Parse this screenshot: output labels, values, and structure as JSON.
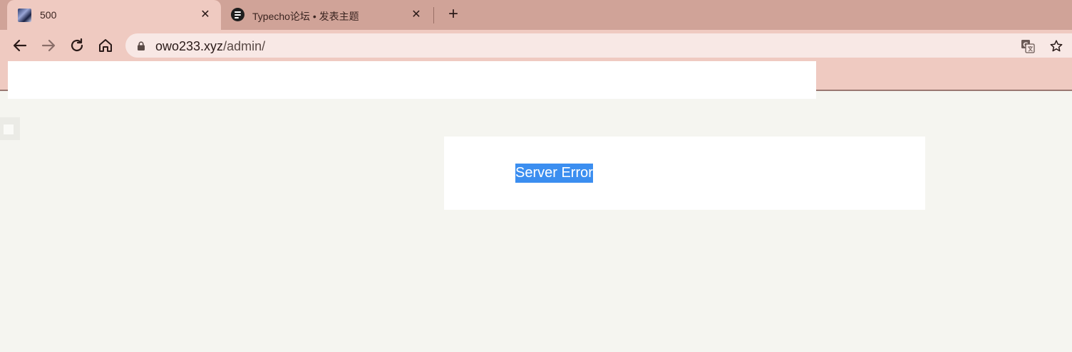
{
  "browser": {
    "tabs": [
      {
        "title": "500",
        "active": true,
        "icon": "anime-avatar-favicon"
      },
      {
        "title": "Typecho论坛 • 发表主题",
        "active": false,
        "icon": "typecho-favicon"
      }
    ],
    "new_tab_label": "+",
    "close_label": "✕",
    "address_bar": {
      "host": "owo233.xyz",
      "path": "/admin/"
    }
  },
  "page": {
    "error_message": "Server Error"
  },
  "colors": {
    "tab_strip": "#d0a398",
    "toolbar": "#efcac1",
    "omnibox": "#f8e8e5",
    "page_background": "#f5f5f0",
    "selection": "#3b8ef0"
  }
}
